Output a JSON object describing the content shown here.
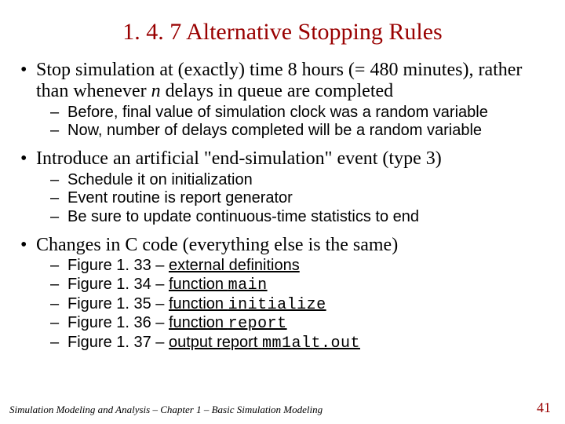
{
  "title": "1. 4. 7  Alternative Stopping Rules",
  "bullets": [
    {
      "pre": "Stop simulation at (exactly) time 8 hours (= 480 minutes), rather than whenever ",
      "em": "n",
      "post": " delays in queue are completed",
      "subs": [
        {
          "text": "Before, final value of simulation clock was a random variable"
        },
        {
          "text": "Now, number of delays completed will be a random variable"
        }
      ]
    },
    {
      "pre": "Introduce an artificial \"end-simulation\" event (type 3)",
      "subs": [
        {
          "text": "Schedule it on initialization"
        },
        {
          "text": "Event routine is report generator"
        },
        {
          "text": "Be sure to update continuous-time statistics to end"
        }
      ]
    },
    {
      "pre": "Changes in C code (everything else is the same)",
      "subs": [
        {
          "pre": "Figure 1. 33 – ",
          "uline": "external definitions"
        },
        {
          "pre": "Figure 1. 34 – ",
          "uline": "function ",
          "mono": "main"
        },
        {
          "pre": "Figure 1. 35 – ",
          "uline": "function ",
          "mono": "initialize"
        },
        {
          "pre": "Figure 1. 36 – ",
          "uline": "function ",
          "mono": "report"
        },
        {
          "pre": "Figure 1. 37 – ",
          "uline": "output report ",
          "mono": "mm1alt.out"
        }
      ]
    }
  ],
  "footer": "Simulation Modeling and Analysis – Chapter 1 – Basic Simulation Modeling",
  "page": "41"
}
